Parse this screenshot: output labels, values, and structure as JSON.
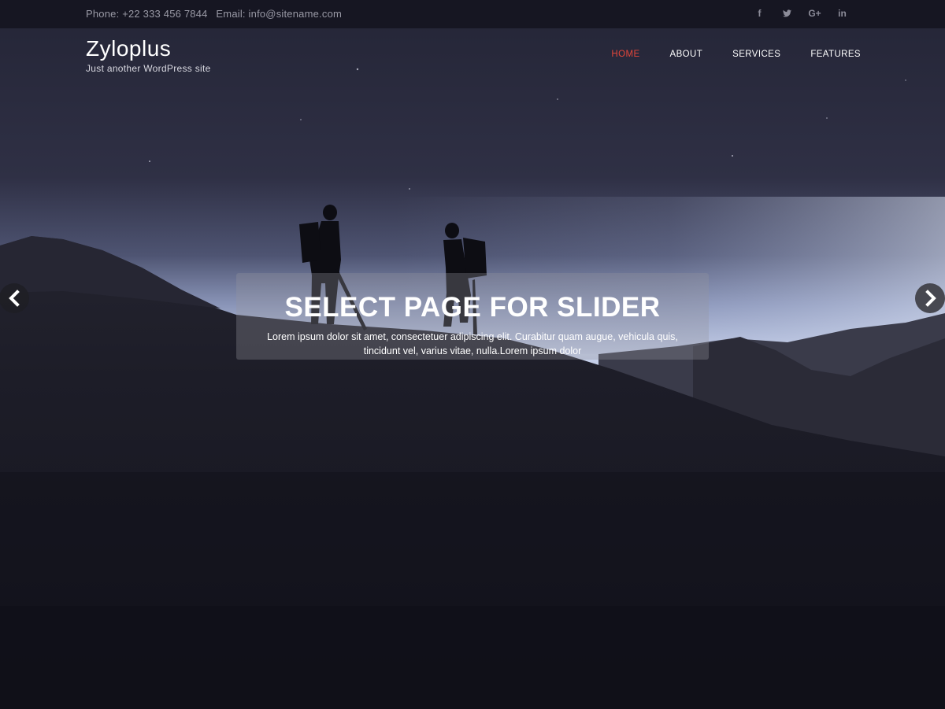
{
  "topbar": {
    "phone": "Phone: +22 333 456 7844",
    "email": "Email: info@sitename.com",
    "social": [
      {
        "icon": "facebook-icon",
        "glyph": "f"
      },
      {
        "icon": "twitter-icon",
        "glyph": "y"
      },
      {
        "icon": "google-plus-icon",
        "glyph": "G+"
      },
      {
        "icon": "linkedin-icon",
        "glyph": "in"
      }
    ]
  },
  "header": {
    "site_title": "Zyloplus",
    "tagline": "Just another WordPress site"
  },
  "nav": {
    "items": [
      {
        "label": "HOME",
        "active": true
      },
      {
        "label": "ABOUT",
        "active": false
      },
      {
        "label": "SERVICES",
        "active": false
      },
      {
        "label": "FEATURES",
        "active": false
      }
    ]
  },
  "slider": {
    "heading": "SELECT PAGE FOR SLIDER",
    "text": "Lorem ipsum dolor sit amet, consectetuer adipiscing elit. Curabitur quam augue, vehicula quis, tincidunt vel, varius vitae, nulla.Lorem ipsum dolor",
    "prev_icon": "chevron-left-icon",
    "next_icon": "chevron-right-icon"
  },
  "colors": {
    "accent": "#e2463a",
    "sky_top": "#2a2b3e",
    "sky_horizon": "#c9d3ea",
    "ground": "#15151f"
  }
}
